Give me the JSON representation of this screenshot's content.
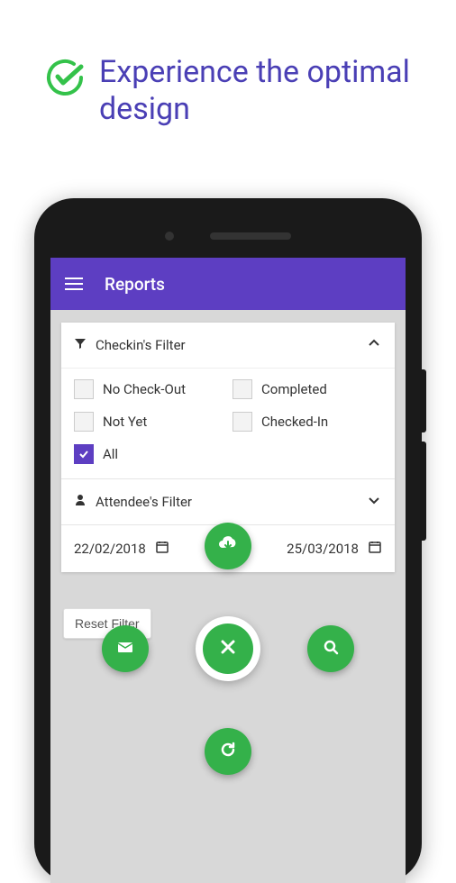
{
  "promo": {
    "text": "Experience the optimal design"
  },
  "app": {
    "title": "Reports"
  },
  "filters": {
    "checkin": {
      "title": "Checkin's Filter",
      "options": [
        {
          "label": "No Check-Out",
          "checked": false
        },
        {
          "label": "Completed",
          "checked": false
        },
        {
          "label": "Not Yet",
          "checked": false
        },
        {
          "label": "Checked-In",
          "checked": false
        },
        {
          "label": "All",
          "checked": true
        }
      ]
    },
    "attendee": {
      "title": "Attendee's Filter"
    },
    "dates": {
      "from": "22/02/2018",
      "to": "25/03/2018"
    }
  },
  "buttons": {
    "reset": "Reset Filter"
  }
}
